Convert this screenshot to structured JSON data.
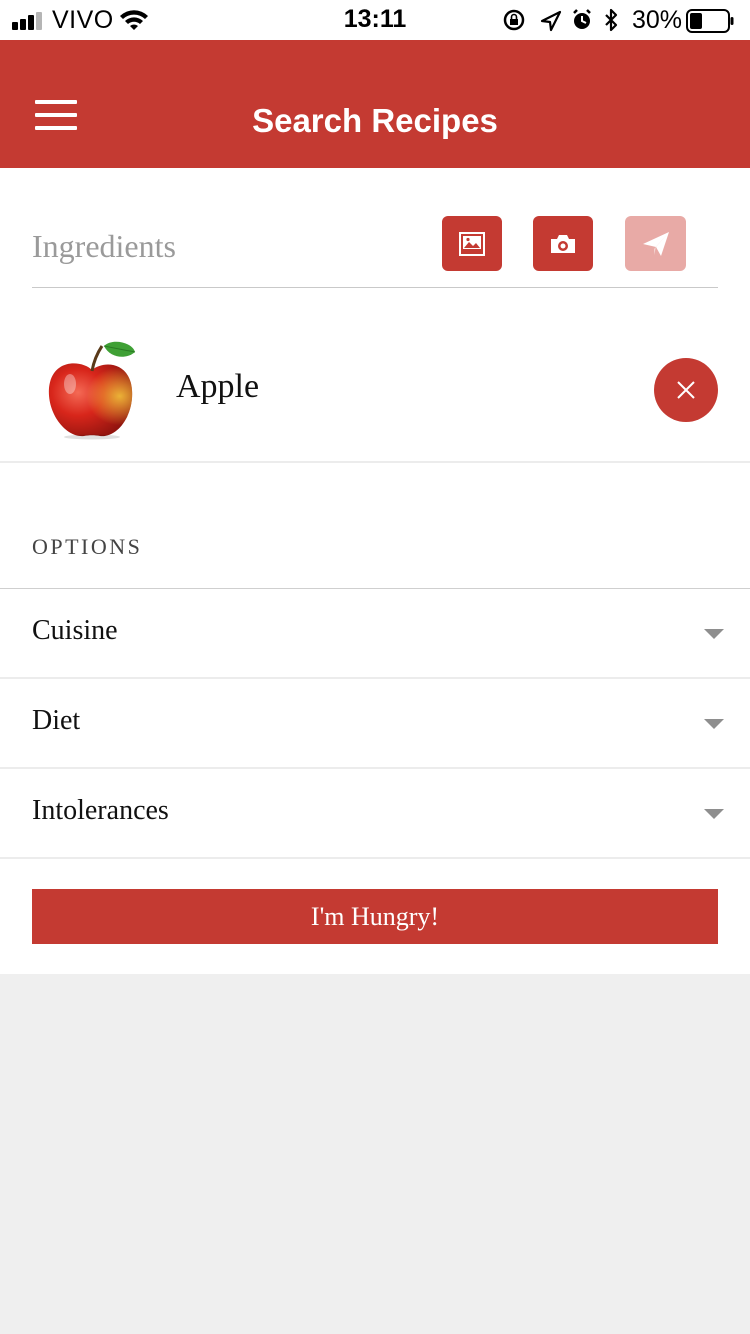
{
  "status_bar": {
    "carrier": "VIVO",
    "time": "13:11",
    "battery": "30%",
    "icons": [
      "signal-icon",
      "wifi-icon",
      "rotation-lock-icon",
      "location-icon",
      "alarm-icon",
      "bluetooth-icon",
      "battery-icon"
    ]
  },
  "header": {
    "title": "Search Recipes",
    "menu_icon": "hamburger-menu-icon"
  },
  "search": {
    "placeholder": "Ingredients",
    "value": "",
    "actions": [
      {
        "name": "gallery",
        "icon": "image-icon",
        "enabled": true
      },
      {
        "name": "camera",
        "icon": "camera-icon",
        "enabled": true
      },
      {
        "name": "send",
        "icon": "paper-plane-icon",
        "enabled": false
      }
    ]
  },
  "ingredients": [
    {
      "name": "Apple",
      "icon": "apple-icon"
    }
  ],
  "options": {
    "heading": "OPTIONS",
    "items": [
      {
        "label": "Cuisine"
      },
      {
        "label": "Diet"
      },
      {
        "label": "Intolerances"
      }
    ]
  },
  "submit": {
    "label": "I'm Hungry!"
  },
  "colors": {
    "brand": "#c43a32",
    "brand_disabled": "#e8aaa6",
    "background": "#efefef",
    "surface": "#ffffff"
  }
}
